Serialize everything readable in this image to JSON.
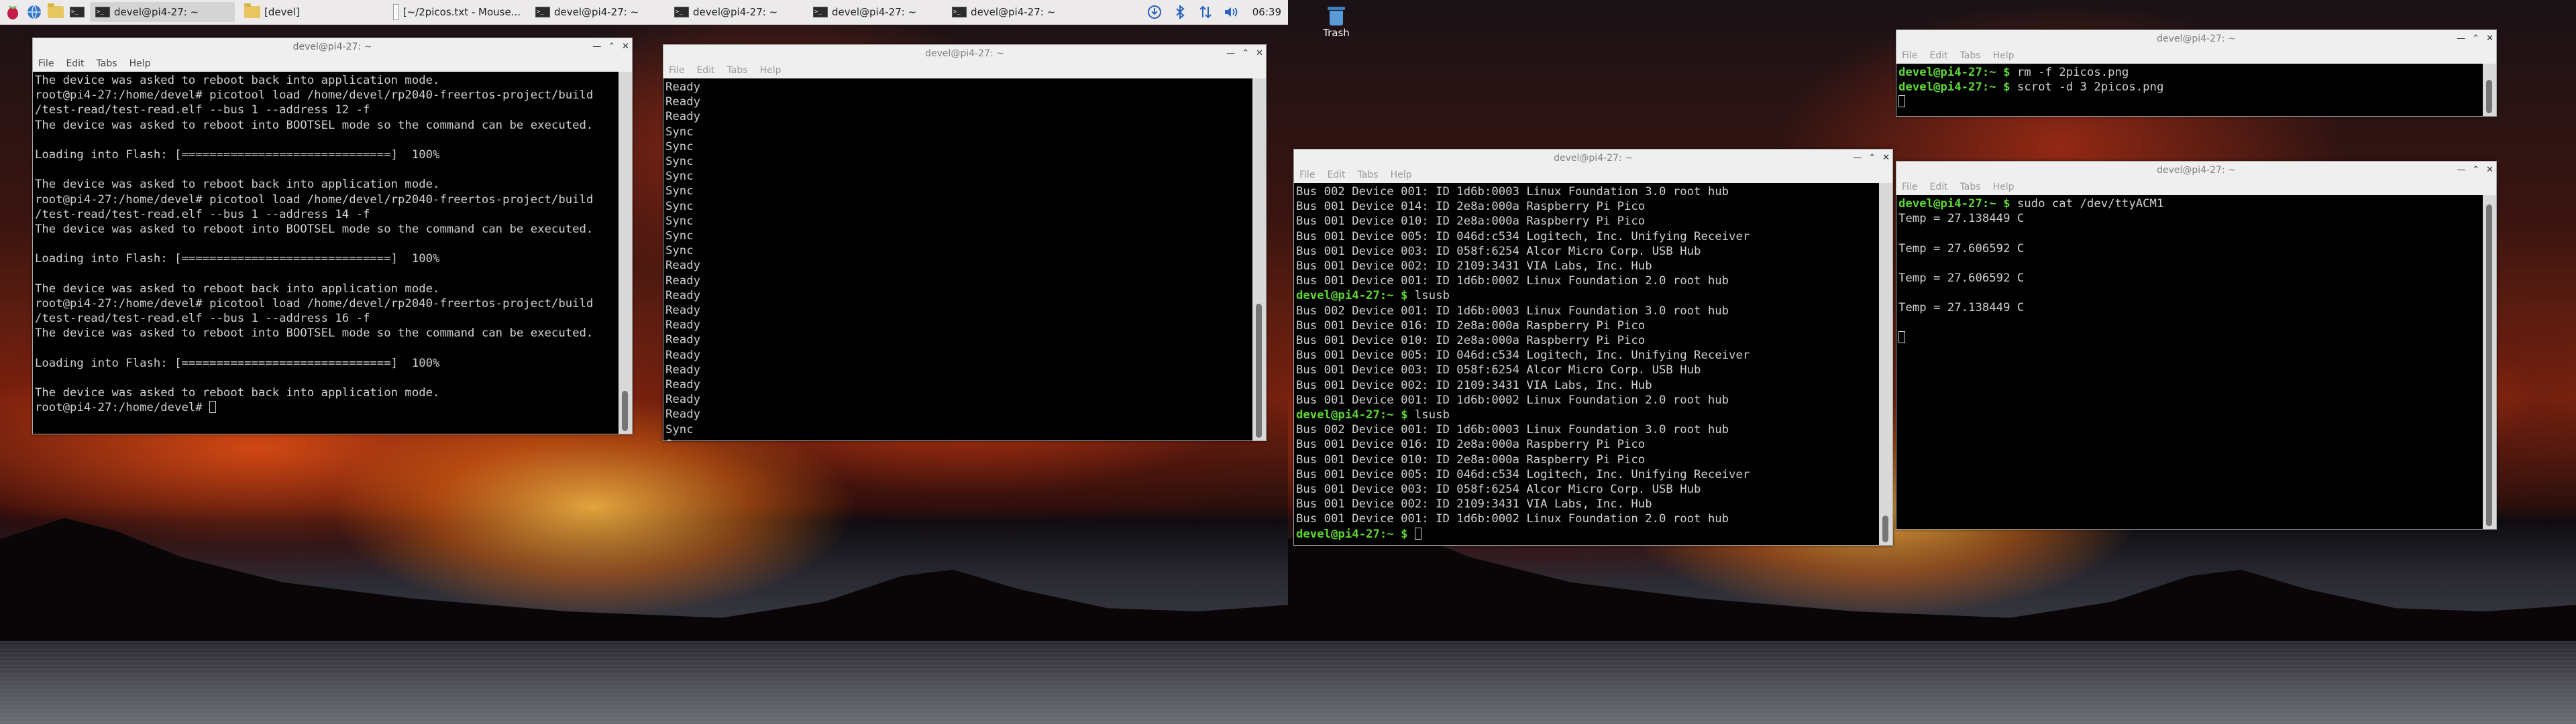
{
  "taskbar": {
    "tasks": [
      {
        "label": "devel@pi4-27: ~"
      },
      {
        "label": "[devel]"
      },
      {
        "label": "[~/2picos.txt - Mouse..."
      },
      {
        "label": "devel@pi4-27: ~"
      },
      {
        "label": "devel@pi4-27: ~"
      },
      {
        "label": "devel@pi4-27: ~"
      },
      {
        "label": "devel@pi4-27: ~"
      }
    ],
    "clock": "06:39"
  },
  "desktop": {
    "trash_label": "Trash"
  },
  "menu": {
    "file": "File",
    "edit": "Edit",
    "tabs": "Tabs",
    "help": "Help"
  },
  "windows": {
    "w1": {
      "title": "devel@pi4-27: ~",
      "lines": [
        "The device was asked to reboot back into application mode.",
        "root@pi4-27:/home/devel# picotool load /home/devel/rp2040-freertos-project/build",
        "/test-read/test-read.elf --bus 1 --address 12 -f",
        "The device was asked to reboot into BOOTSEL mode so the command can be executed.",
        "",
        "Loading into Flash: [==============================]  100%",
        "",
        "The device was asked to reboot back into application mode.",
        "root@pi4-27:/home/devel# picotool load /home/devel/rp2040-freertos-project/build",
        "/test-read/test-read.elf --bus 1 --address 14 -f",
        "The device was asked to reboot into BOOTSEL mode so the command can be executed.",
        "",
        "Loading into Flash: [==============================]  100%",
        "",
        "The device was asked to reboot back into application mode.",
        "root@pi4-27:/home/devel# picotool load /home/devel/rp2040-freertos-project/build",
        "/test-read/test-read.elf --bus 1 --address 16 -f",
        "The device was asked to reboot into BOOTSEL mode so the command can be executed.",
        "",
        "Loading into Flash: [==============================]  100%",
        "",
        "The device was asked to reboot back into application mode."
      ],
      "last_line": "root@pi4-27:/home/devel# "
    },
    "w2": {
      "title": "devel@pi4-27: ~",
      "lines": [
        "Ready",
        "Ready",
        "Ready",
        "Sync",
        "Sync",
        "Sync",
        "Sync",
        "Sync",
        "Sync",
        "Sync",
        "Sync",
        "Sync",
        "Ready",
        "Ready",
        "Ready",
        "Ready",
        "Ready",
        "Ready",
        "Ready",
        "Ready",
        "Ready",
        "Ready",
        "Ready",
        "Sync",
        "Sync"
      ]
    },
    "w3": {
      "title": "devel@pi4-27: ~",
      "prompt": "devel@pi4-27:~ $",
      "lines": [
        {
          "t": "Bus 002 Device 001: ID 1d6b:0003 Linux Foundation 3.0 root hub"
        },
        {
          "t": "Bus 001 Device 014: ID 2e8a:000a Raspberry Pi Pico"
        },
        {
          "t": "Bus 001 Device 010: ID 2e8a:000a Raspberry Pi Pico"
        },
        {
          "t": "Bus 001 Device 005: ID 046d:c534 Logitech, Inc. Unifying Receiver"
        },
        {
          "t": "Bus 001 Device 003: ID 058f:6254 Alcor Micro Corp. USB Hub"
        },
        {
          "t": "Bus 001 Device 002: ID 2109:3431 VIA Labs, Inc. Hub"
        },
        {
          "t": "Bus 001 Device 001: ID 1d6b:0002 Linux Foundation 2.0 root hub"
        },
        {
          "p": "devel@pi4-27:~ $",
          "t": " lsusb"
        },
        {
          "t": "Bus 002 Device 001: ID 1d6b:0003 Linux Foundation 3.0 root hub"
        },
        {
          "t": "Bus 001 Device 016: ID 2e8a:000a Raspberry Pi Pico"
        },
        {
          "t": "Bus 001 Device 010: ID 2e8a:000a Raspberry Pi Pico"
        },
        {
          "t": "Bus 001 Device 005: ID 046d:c534 Logitech, Inc. Unifying Receiver"
        },
        {
          "t": "Bus 001 Device 003: ID 058f:6254 Alcor Micro Corp. USB Hub"
        },
        {
          "t": "Bus 001 Device 002: ID 2109:3431 VIA Labs, Inc. Hub"
        },
        {
          "t": "Bus 001 Device 001: ID 1d6b:0002 Linux Foundation 2.0 root hub"
        },
        {
          "p": "devel@pi4-27:~ $",
          "t": " lsusb"
        },
        {
          "t": "Bus 002 Device 001: ID 1d6b:0003 Linux Foundation 3.0 root hub"
        },
        {
          "t": "Bus 001 Device 016: ID 2e8a:000a Raspberry Pi Pico"
        },
        {
          "t": "Bus 001 Device 010: ID 2e8a:000a Raspberry Pi Pico"
        },
        {
          "t": "Bus 001 Device 005: ID 046d:c534 Logitech, Inc. Unifying Receiver"
        },
        {
          "t": "Bus 001 Device 003: ID 058f:6254 Alcor Micro Corp. USB Hub"
        },
        {
          "t": "Bus 001 Device 002: ID 2109:3431 VIA Labs, Inc. Hub"
        },
        {
          "t": "Bus 001 Device 001: ID 1d6b:0002 Linux Foundation 2.0 root hub"
        },
        {
          "p": "devel@pi4-27:~ $",
          "t": " "
        }
      ]
    },
    "w4": {
      "title": "devel@pi4-27: ~",
      "lines": [
        {
          "p": "devel@pi4-27:~ $",
          "t": " rm -f 2picos.png"
        },
        {
          "p": "devel@pi4-27:~ $",
          "t": " scrot -d 3 2picos.png"
        }
      ]
    },
    "w5": {
      "title": "devel@pi4-27: ~",
      "lines": [
        {
          "p": "devel@pi4-27:~ $",
          "t": " sudo cat /dev/ttyACM1"
        },
        {
          "t": "Temp = 27.138449 C"
        },
        {
          "t": ""
        },
        {
          "t": "Temp = 27.606592 C"
        },
        {
          "t": ""
        },
        {
          "t": "Temp = 27.606592 C"
        },
        {
          "t": ""
        },
        {
          "t": "Temp = 27.138449 C"
        },
        {
          "t": ""
        }
      ]
    }
  },
  "colors": {
    "prompt": "#5dd832",
    "terminal_bg": "#000000",
    "terminal_fg": "#d0d0d0"
  }
}
